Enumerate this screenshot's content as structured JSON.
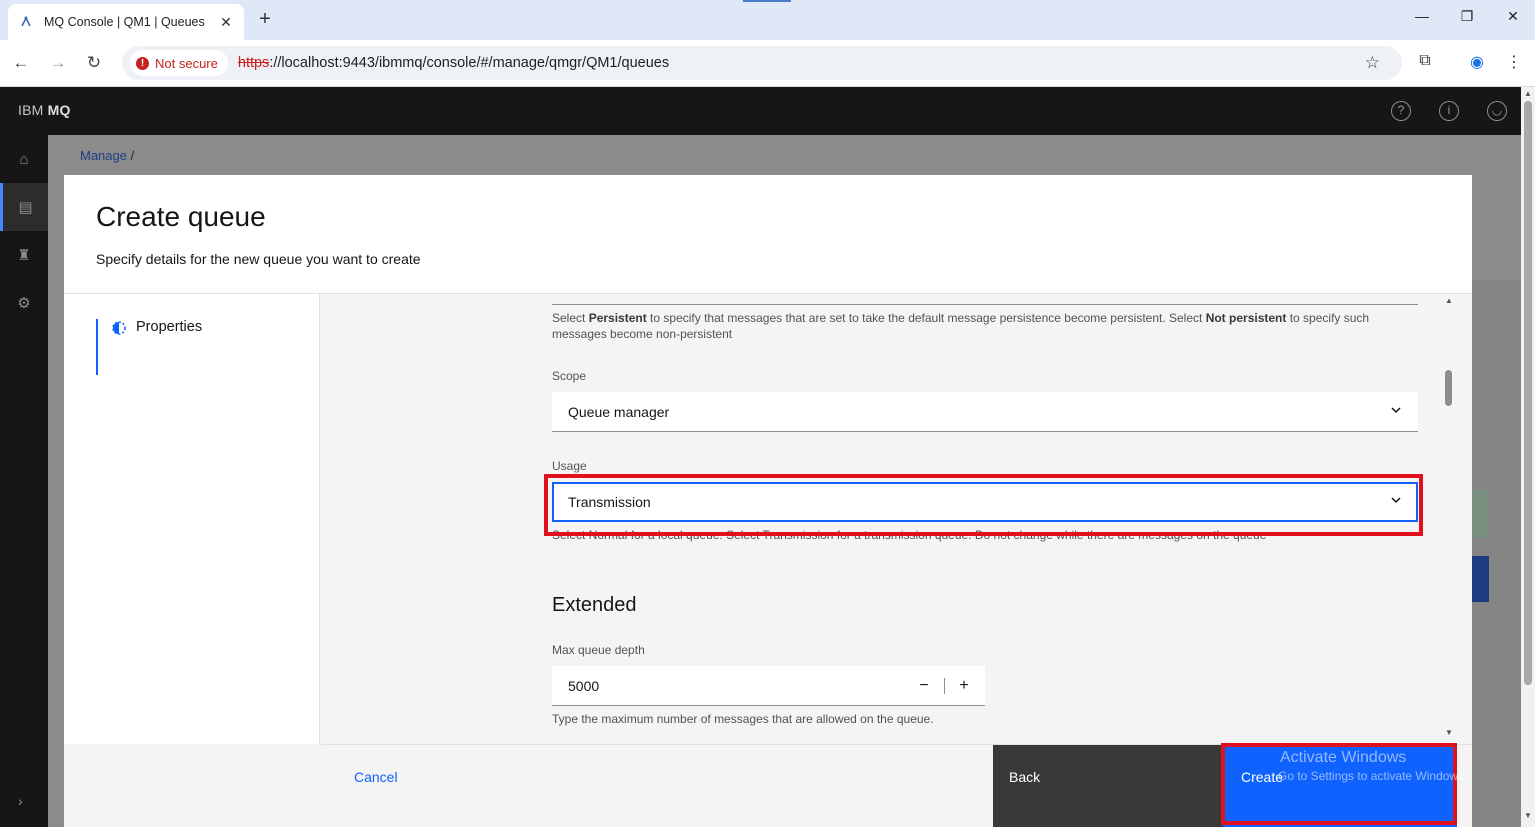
{
  "browser": {
    "tab_title": "MQ Console | QM1 | Queues",
    "new_tab": "+",
    "security_label": "Not secure",
    "url_scheme": "https",
    "url_rest": "://localhost:9443/ibmmq/console/#/manage/qmgr/QM1/queues"
  },
  "app": {
    "brand_prefix": "IBM",
    "brand_name": "MQ"
  },
  "breadcrumb": {
    "item": "Manage",
    "separator": "/"
  },
  "modal": {
    "title": "Create queue",
    "subtitle": "Specify details for the new queue you want to create",
    "nav_step": "Properties"
  },
  "form": {
    "persistence_help": [
      {
        "text": "Select ",
        "bold": false
      },
      {
        "text": "Persistent",
        "bold": true
      },
      {
        "text": " to specify that messages that are set to take the default message persistence become persistent. Select ",
        "bold": false
      },
      {
        "text": "Not persistent",
        "bold": true
      },
      {
        "text": " to specify such messages become non-persistent",
        "bold": false
      }
    ],
    "scope_label": "Scope",
    "scope_value": "Queue manager",
    "usage_label": "Usage",
    "usage_value": "Transmission",
    "usage_help": "Select Normal for a local queue. Select Transmission for a transmission queue. Do not change while there are messages on the queue",
    "extended_title": "Extended",
    "max_depth_label": "Max queue depth",
    "max_depth_value": "5000",
    "max_depth_help": "Type the maximum number of messages that are allowed on the queue."
  },
  "footer": {
    "cancel": "Cancel",
    "back": "Back",
    "create": "Create"
  },
  "watermark": {
    "line1": "Activate Windows",
    "line2": "Go to Settings to activate Windows."
  },
  "colors": {
    "primary_button": "#0f62fe",
    "highlight": "#e0101e",
    "header_bg": "#161616"
  }
}
